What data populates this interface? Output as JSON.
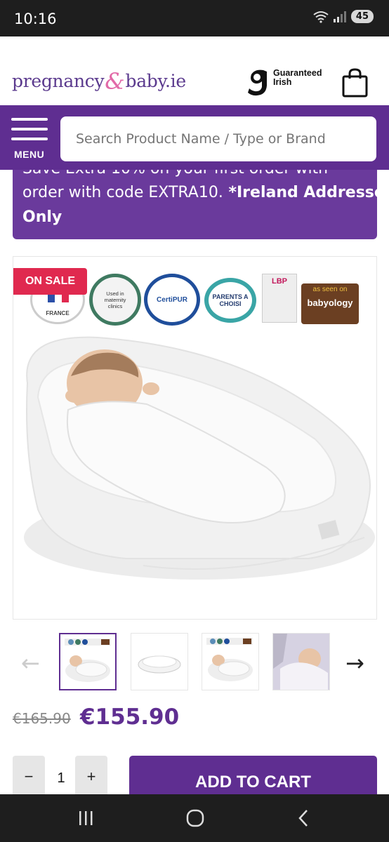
{
  "status_bar": {
    "time": "10:16",
    "battery": "45"
  },
  "header": {
    "logo_left": "pregnancy",
    "logo_amp": "&",
    "logo_right": "baby.ie",
    "guarantee_line1": "Guaranteed",
    "guarantee_line2": "Irish"
  },
  "nav": {
    "menu_label": "MENU",
    "search_placeholder": "Search Product Name / Type or Brand"
  },
  "promo": {
    "line1": "Save Extra 10% on your first order with",
    "line2": "order with code EXTRA10.",
    "line2_bold": " *Ireland Addresses",
    "line3": "Only"
  },
  "product": {
    "sale_badge": "ON SALE",
    "cert_labels": [
      "FRANCE",
      "Used in maternity clinics",
      "CertiPUR",
      "PARENTS A CHOISI",
      "LBP",
      "as seen on",
      "babyology"
    ]
  },
  "pricing": {
    "old_price": "€165.90",
    "new_price": "€155.90"
  },
  "cart": {
    "minus": "−",
    "quantity": "1",
    "plus": "+",
    "add_label": "ADD TO CART"
  },
  "colors": {
    "brand_purple": "#5f2e91",
    "sale_red": "#e0294f",
    "logo_pink": "#e26aa8"
  }
}
